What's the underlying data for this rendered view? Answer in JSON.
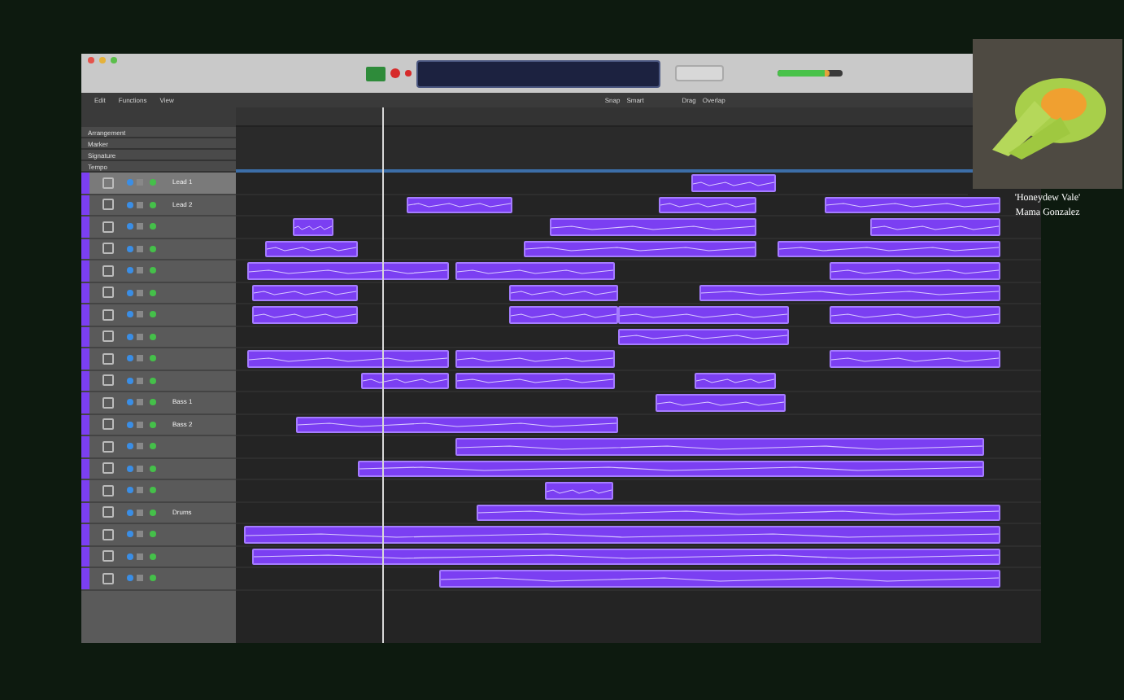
{
  "window": {
    "menus": [
      "Edit",
      "Functions",
      "View"
    ],
    "snap_label": "Snap",
    "snap_value": "Smart",
    "drag_label": "Drag",
    "drag_value": "Overlap"
  },
  "transport": {
    "playing": true,
    "recording": false,
    "volume": {
      "level": 0.8
    }
  },
  "global_tracks": [
    "Arrangement",
    "Marker",
    "Signature",
    "Tempo"
  ],
  "tracks": [
    {
      "name": "Lead 1",
      "selected": true
    },
    {
      "name": "Lead 2",
      "selected": false
    },
    {
      "selected": false
    },
    {
      "selected": false
    },
    {
      "selected": false
    },
    {
      "selected": false
    },
    {
      "selected": false
    },
    {
      "selected": false
    },
    {
      "selected": false
    },
    {
      "selected": false
    },
    {
      "name": "Bass 1",
      "selected": false
    },
    {
      "name": "Bass 2",
      "selected": false
    },
    {
      "selected": false
    },
    {
      "selected": false
    },
    {
      "selected": false
    },
    {
      "name": "Drums",
      "selected": false
    },
    {
      "selected": false
    },
    {
      "selected": false
    },
    {
      "selected": false
    }
  ],
  "overlay": {
    "song_title": "'Honeydew Vale'",
    "artist": "Mama Gonzalez"
  }
}
